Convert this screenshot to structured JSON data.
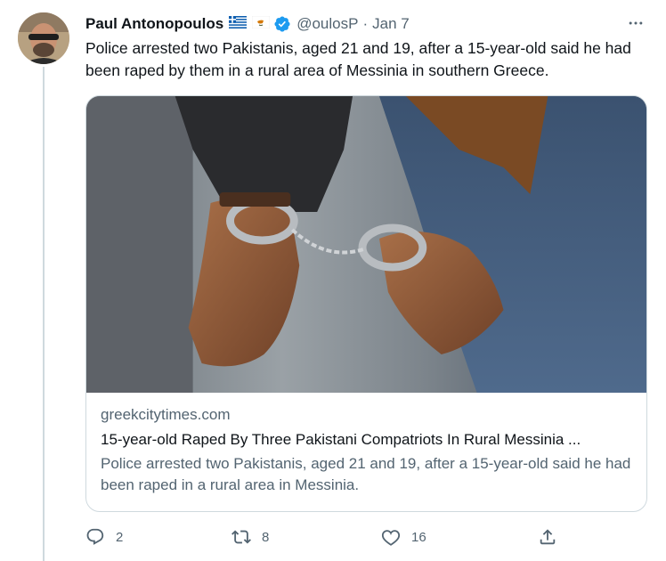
{
  "tweet": {
    "author_name": "Paul Antonopoulos",
    "handle": "@oulosP",
    "separator": "·",
    "date": "Jan 7",
    "text": "Police arrested two Pakistanis, aged 21 and 19, after a 15-year-old said he had been raped by them in a rural area of Messinia in southern Greece."
  },
  "card": {
    "domain": "greekcitytimes.com",
    "title": "15-year-old Raped By Three Pakistani Compatriots In Rural Messinia ...",
    "description": "Police arrested two Pakistanis, aged 21 and 19, after a 15-year-old said he had been raped in a rural area in Messinia."
  },
  "actions": {
    "replies": "2",
    "retweets": "8",
    "likes": "16"
  },
  "icons": [
    "more-icon",
    "verified-icon",
    "greece-flag-icon",
    "cyprus-flag-icon",
    "reply-icon",
    "retweet-icon",
    "like-icon",
    "share-icon"
  ],
  "colors": {
    "verified": "#1d9bf0",
    "secondary_text": "#536471",
    "border": "#cfd9de"
  }
}
